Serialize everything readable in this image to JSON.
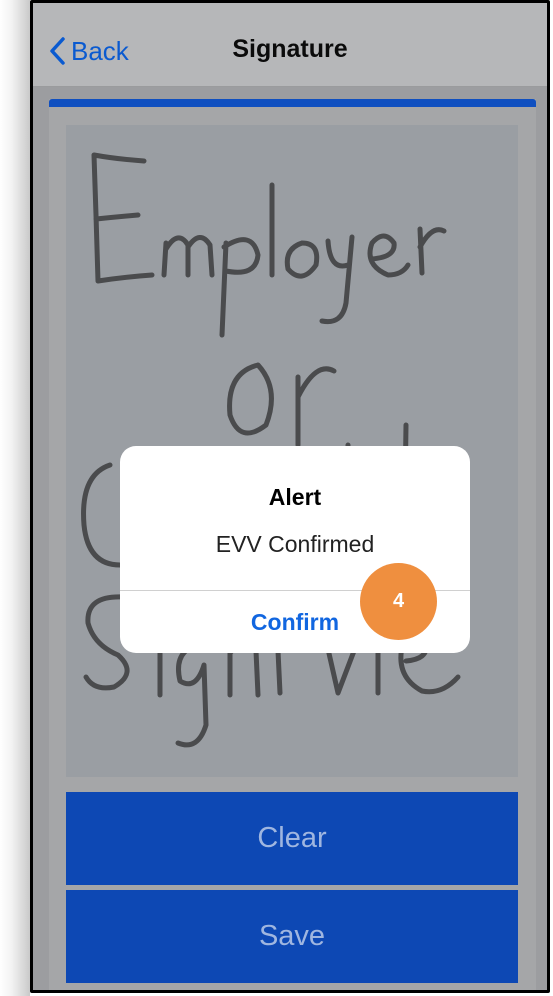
{
  "colors": {
    "accent": "#0f4fc0",
    "button_bg": "#0d48b4",
    "link": "#1166e0",
    "badge": "#ef8f3f"
  },
  "navbar": {
    "back_label": "Back",
    "back_icon": "chevron-left-icon",
    "title": "Signature"
  },
  "signature_pad": {
    "handwritten_text": "Employer or Client Signature"
  },
  "buttons": {
    "clear_label": "Clear",
    "save_label": "Save"
  },
  "alert": {
    "title": "Alert",
    "message": "EVV Confirmed",
    "confirm_label": "Confirm"
  },
  "step_badge": {
    "number": "4"
  }
}
